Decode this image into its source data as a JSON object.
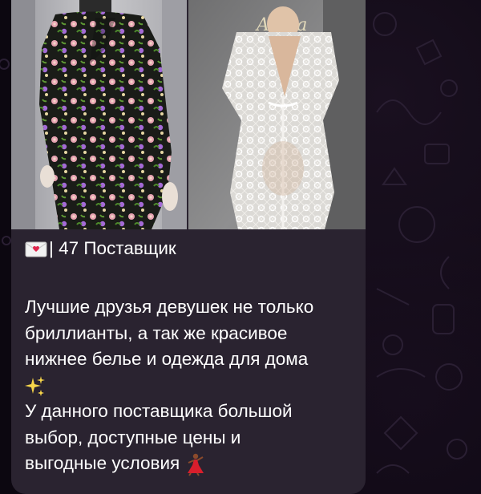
{
  "post": {
    "title_emoji": "envelope-with-heart-icon",
    "title_text": "| 47 Поставщик",
    "desc_line1": "Лучшие друзья девушек не только",
    "desc_line2": "бриллианты, а так же красивое",
    "desc_line3": "нижнее белье и одежда для дома",
    "sparkle_emoji": "sparkles-icon",
    "detail_line1": "У данного поставщика большой",
    "detail_line2": "выбор, доступные цены и",
    "detail_line3": "выгодные условия",
    "dancer_emoji": "dancer-icon"
  },
  "media": {
    "left_photo": "floral black long-sleeve dress on mannequin",
    "right_photo": "white lace sheer robe on mannequin"
  },
  "colors": {
    "bubble_bg": "#2a2330",
    "chat_bg": "#0c0710",
    "text": "#ffffff"
  }
}
